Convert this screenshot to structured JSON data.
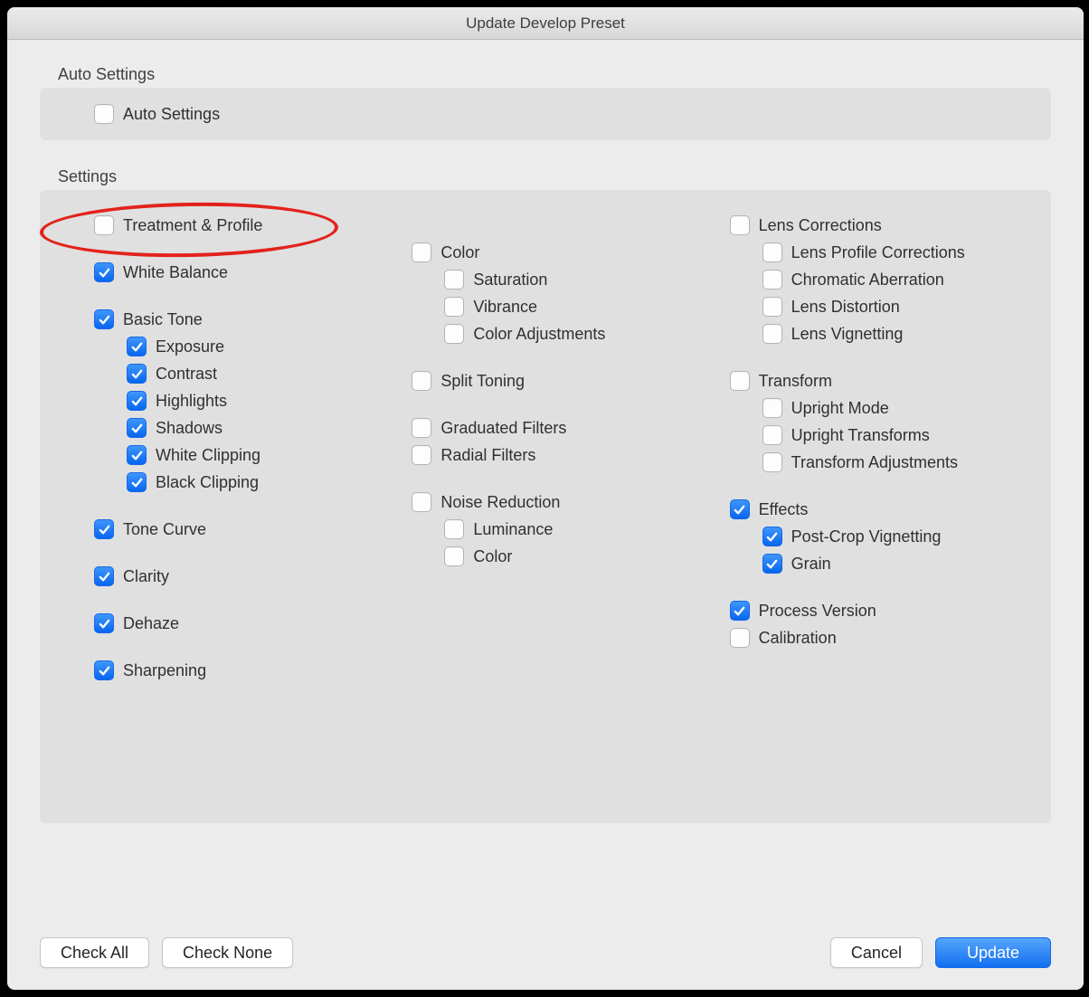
{
  "title": "Update Develop Preset",
  "auto_section_label": "Auto Settings",
  "auto_settings": {
    "label": "Auto Settings",
    "checked": false
  },
  "settings_label": "Settings",
  "col1": [
    {
      "type": "item",
      "label": "Treatment & Profile",
      "checked": false
    },
    {
      "type": "gap"
    },
    {
      "type": "item",
      "label": "White Balance",
      "checked": true
    },
    {
      "type": "gap"
    },
    {
      "type": "item",
      "label": "Basic Tone",
      "checked": true
    },
    {
      "type": "child",
      "label": "Exposure",
      "checked": true
    },
    {
      "type": "child",
      "label": "Contrast",
      "checked": true
    },
    {
      "type": "child",
      "label": "Highlights",
      "checked": true
    },
    {
      "type": "child",
      "label": "Shadows",
      "checked": true
    },
    {
      "type": "child",
      "label": "White Clipping",
      "checked": true
    },
    {
      "type": "child",
      "label": "Black Clipping",
      "checked": true
    },
    {
      "type": "gap"
    },
    {
      "type": "item",
      "label": "Tone Curve",
      "checked": true
    },
    {
      "type": "gap"
    },
    {
      "type": "item",
      "label": "Clarity",
      "checked": true
    },
    {
      "type": "gap"
    },
    {
      "type": "item",
      "label": "Dehaze",
      "checked": true
    },
    {
      "type": "gap"
    },
    {
      "type": "item",
      "label": "Sharpening",
      "checked": true
    }
  ],
  "col2": [
    {
      "type": "item",
      "label": "Color",
      "checked": false
    },
    {
      "type": "child",
      "label": "Saturation",
      "checked": false
    },
    {
      "type": "child",
      "label": "Vibrance",
      "checked": false
    },
    {
      "type": "child",
      "label": "Color Adjustments",
      "checked": false
    },
    {
      "type": "gap"
    },
    {
      "type": "item",
      "label": "Split Toning",
      "checked": false
    },
    {
      "type": "gap"
    },
    {
      "type": "item",
      "label": "Graduated Filters",
      "checked": false
    },
    {
      "type": "item",
      "label": "Radial Filters",
      "checked": false
    },
    {
      "type": "gap"
    },
    {
      "type": "item",
      "label": "Noise Reduction",
      "checked": false
    },
    {
      "type": "child",
      "label": "Luminance",
      "checked": false
    },
    {
      "type": "child",
      "label": "Color",
      "checked": false
    }
  ],
  "col3": [
    {
      "type": "item",
      "label": "Lens Corrections",
      "checked": false
    },
    {
      "type": "child",
      "label": "Lens Profile Corrections",
      "checked": false
    },
    {
      "type": "child",
      "label": "Chromatic Aberration",
      "checked": false
    },
    {
      "type": "child",
      "label": "Lens Distortion",
      "checked": false
    },
    {
      "type": "child",
      "label": "Lens Vignetting",
      "checked": false
    },
    {
      "type": "gap"
    },
    {
      "type": "item",
      "label": "Transform",
      "checked": false
    },
    {
      "type": "child",
      "label": "Upright Mode",
      "checked": false
    },
    {
      "type": "child",
      "label": "Upright Transforms",
      "checked": false
    },
    {
      "type": "child",
      "label": "Transform Adjustments",
      "checked": false
    },
    {
      "type": "gap"
    },
    {
      "type": "item",
      "label": "Effects",
      "checked": true
    },
    {
      "type": "child",
      "label": "Post-Crop Vignetting",
      "checked": true
    },
    {
      "type": "child",
      "label": "Grain",
      "checked": true
    },
    {
      "type": "gap"
    },
    {
      "type": "item",
      "label": "Process Version",
      "checked": true
    },
    {
      "type": "item",
      "label": "Calibration",
      "checked": false
    }
  ],
  "buttons": {
    "check_all": "Check All",
    "check_none": "Check None",
    "cancel": "Cancel",
    "update": "Update"
  }
}
